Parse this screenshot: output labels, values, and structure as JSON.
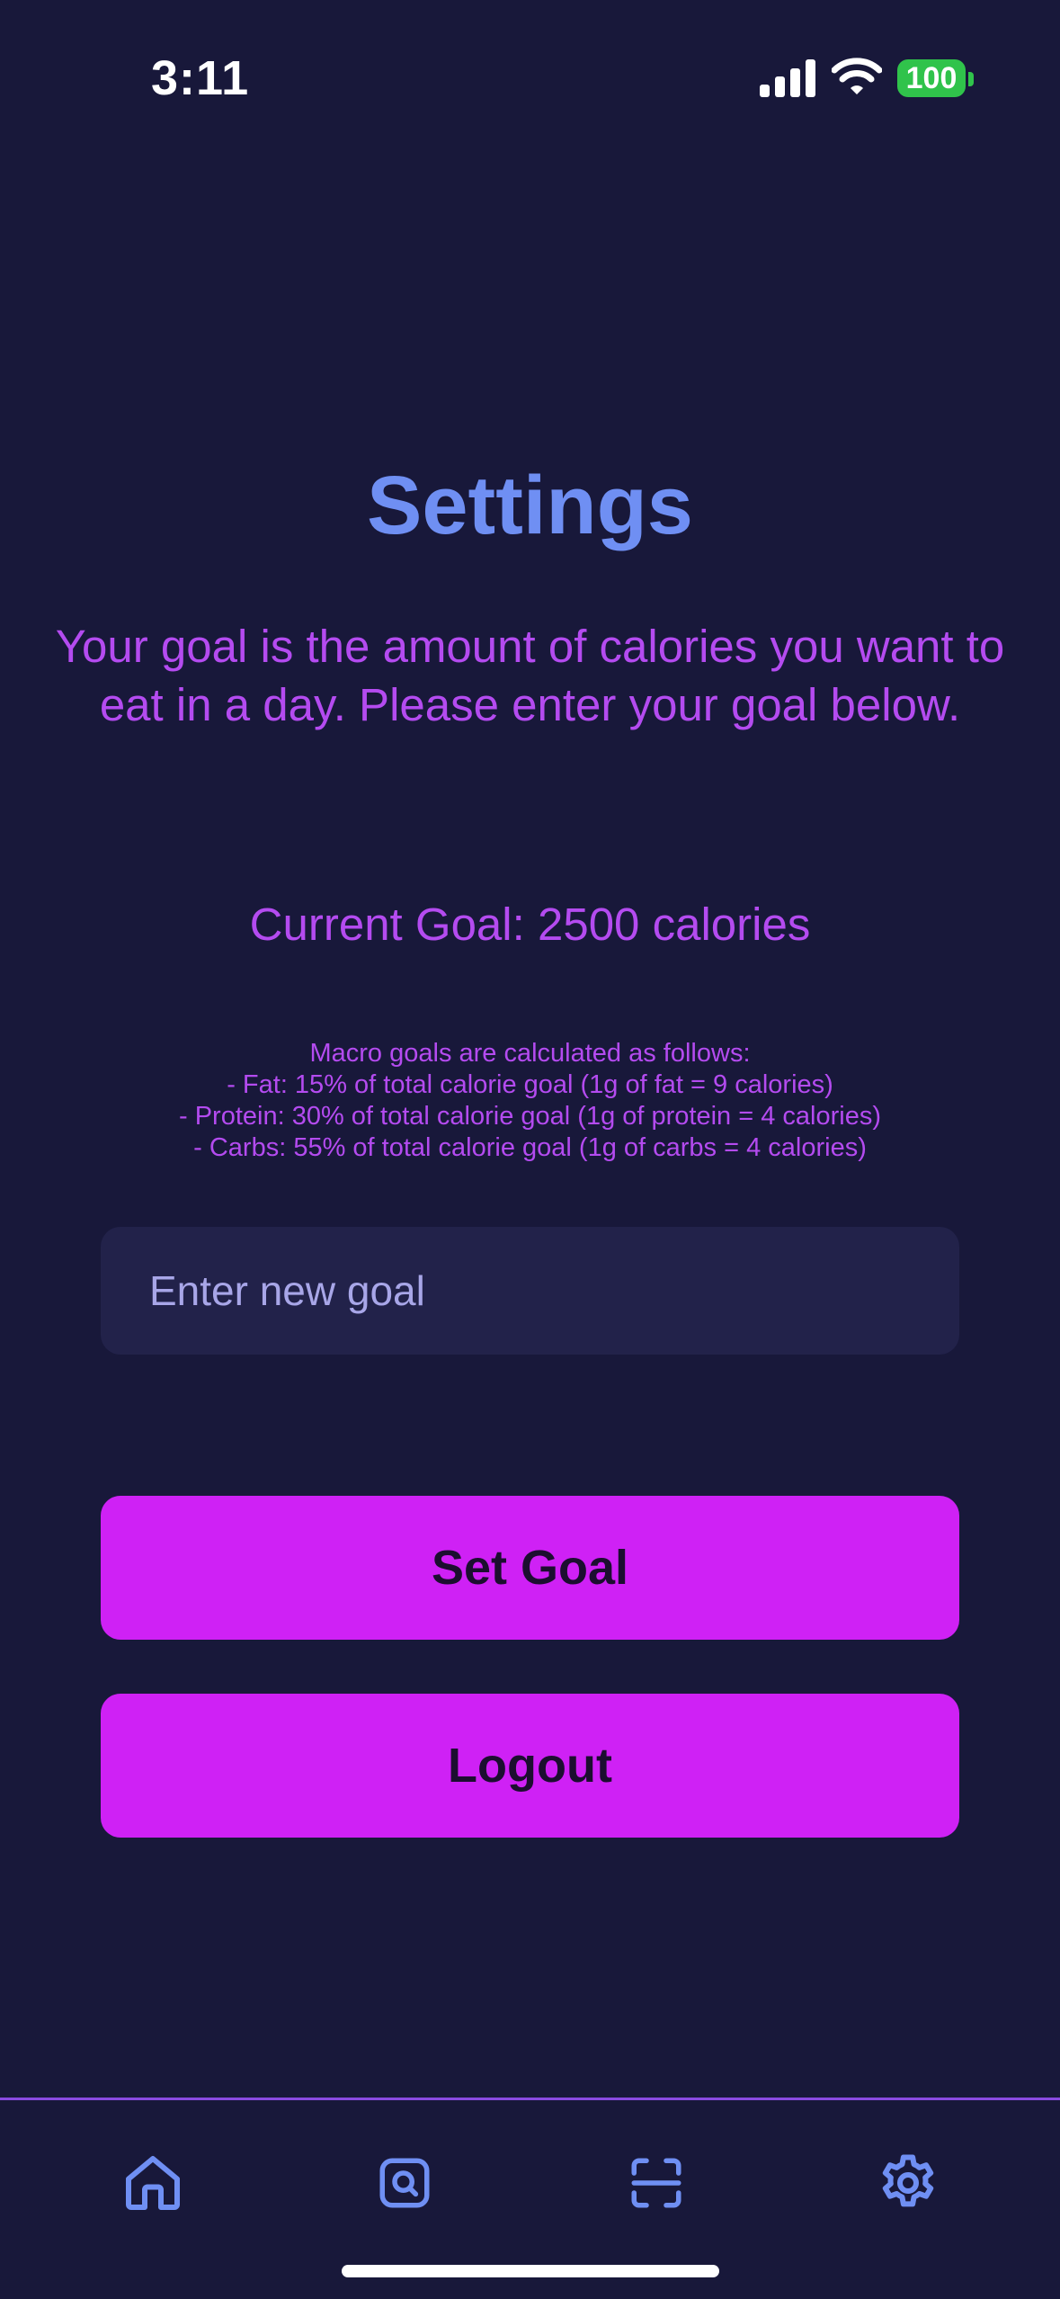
{
  "status_bar": {
    "time": "3:11",
    "battery": "100"
  },
  "page": {
    "title": "Settings",
    "description": "Your goal is the amount of calories you want to eat in a day. Please enter your goal below.",
    "current_goal": "Current Goal: 2500 calories",
    "macro_info": [
      "Macro goals are calculated as follows:",
      "- Fat: 15% of total calorie goal (1g of fat = 9 calories)",
      "- Protein: 30% of total calorie goal (1g of protein = 4 calories)",
      "- Carbs: 55% of total calorie goal (1g of carbs = 4 calories)"
    ]
  },
  "goal_input": {
    "placeholder": "Enter new goal",
    "value": ""
  },
  "buttons": {
    "set_goal": "Set Goal",
    "logout": "Logout"
  },
  "tab_bar": {
    "icons": [
      "home-icon",
      "search-icon",
      "scan-icon",
      "gear-icon"
    ],
    "active": "home-icon"
  },
  "colors": {
    "background": "#18183a",
    "title": "#6f8ff3",
    "text": "#b44bf0",
    "button": "#cf21f5",
    "input_bg": "#22224a",
    "icon": "#6f8ff3",
    "battery": "#30c34b"
  }
}
